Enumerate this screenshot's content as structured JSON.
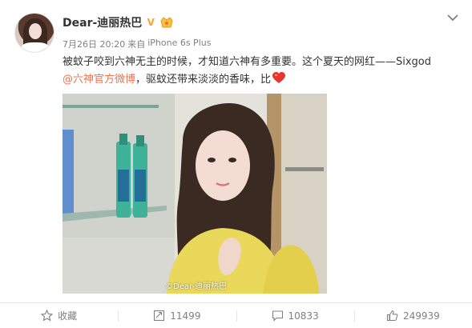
{
  "post": {
    "username": "Dear-迪丽热巴",
    "verified_badge": "V",
    "timestamp": "7月26日 20:20",
    "source_prefix": "来自",
    "source_device": "iPhone 6s Plus",
    "text_line1": "被蚊子咬到六神无主的时候，才知道六神有多重要。这个夏天的网红——Sixgod",
    "mention": "@六神官方微博",
    "text_line2": "，驱蚊还带来淡淡的香味，比",
    "photo_watermark": "©Dear-迪丽热巴"
  },
  "actions": {
    "favorite_label": "收藏",
    "repost_count": "11499",
    "comment_count": "10833",
    "like_count": "249939"
  },
  "colors": {
    "accent": "#eb7350",
    "verified": "#f5a623",
    "heart": "#e8352e",
    "text_secondary": "#808080"
  },
  "icons": {
    "menu": "chevron-down-icon",
    "vip": "vip-badge-icon",
    "heart": "heart-emoji-icon",
    "favorite": "star-icon",
    "repost": "repost-icon",
    "comment": "comment-icon",
    "like": "thumbs-up-icon"
  }
}
